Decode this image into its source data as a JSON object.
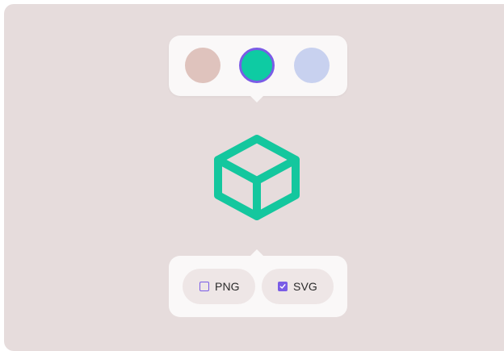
{
  "colors": {
    "background": "#e6dcdc",
    "popover": "#faf8f8",
    "accent": "#7a5ce6",
    "icon": "#14c79e"
  },
  "color_picker": {
    "swatches": [
      {
        "color": "#dfc3bd",
        "selected": false
      },
      {
        "color": "#0ecba3",
        "selected": true
      },
      {
        "color": "#c8d1ef",
        "selected": false
      }
    ]
  },
  "preview": {
    "icon": "cube-icon"
  },
  "export_formats": {
    "png": {
      "label": "PNG",
      "checked": false
    },
    "svg": {
      "label": "SVG",
      "checked": true
    }
  }
}
